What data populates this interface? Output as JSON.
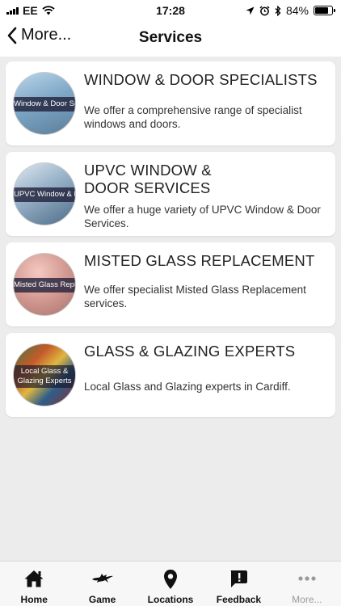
{
  "status": {
    "carrier": "EE",
    "time": "17:28",
    "battery_percent": "84%",
    "battery_level": 0.84
  },
  "nav": {
    "back_label": "More...",
    "title": "Services"
  },
  "services": [
    {
      "title": "WINDOW & DOOR SPECIALISTS",
      "description": "We offer a comprehensive range of specialist windows and doors.",
      "thumb_text": "Window & Door Specialists"
    },
    {
      "title": "UPVC WINDOW & DOOR SERVICES",
      "description": "We offer a huge variety of UPVC Window & Door Services.",
      "thumb_text": "UPVC Window & Door Services"
    },
    {
      "title": "MISTED GLASS REPLACEMENT",
      "description": "We offer specialist Misted Glass Replacement services.",
      "thumb_text": "Misted Glass Replacement"
    },
    {
      "title": "GLASS & GLAZING EXPERTS",
      "description": "Local Glass and Glazing experts in Cardiff.",
      "thumb_text": "Local Glass & Glazing Experts"
    }
  ],
  "tabs": [
    {
      "label": "Home",
      "icon": "home-icon"
    },
    {
      "label": "Game",
      "icon": "game-icon"
    },
    {
      "label": "Locations",
      "icon": "location-pin-icon"
    },
    {
      "label": "Feedback",
      "icon": "feedback-icon"
    },
    {
      "label": "More...",
      "icon": "more-icon"
    }
  ]
}
